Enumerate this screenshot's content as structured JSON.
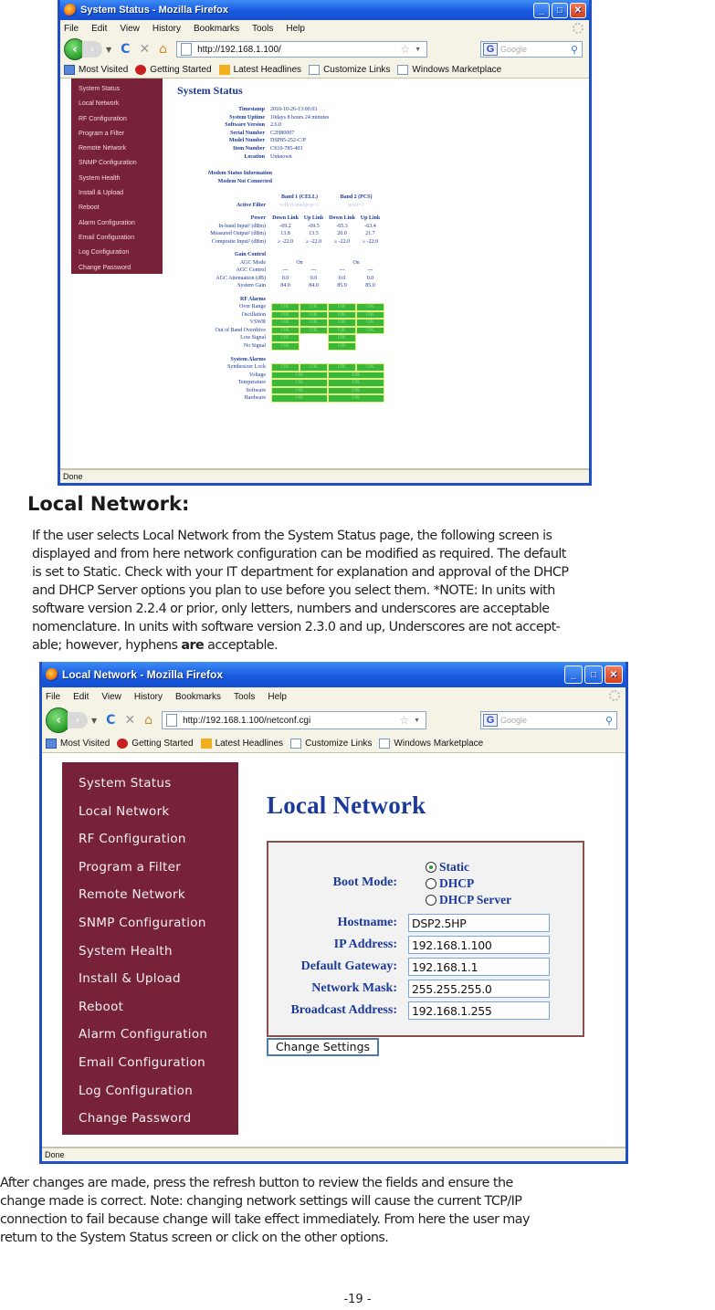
{
  "window1": {
    "title": "System Status - Mozilla Firefox",
    "menu": [
      "File",
      "Edit",
      "View",
      "History",
      "Bookmarks",
      "Tools",
      "Help"
    ],
    "url": "http://192.168.1.100/",
    "search_placeholder": "Google",
    "bookmarks": [
      "Most Visited",
      "Getting Started",
      "Latest Headlines",
      "Customize Links",
      "Windows Marketplace"
    ],
    "status": "Done",
    "sidebar": [
      "System Status",
      "Local Network",
      "RF Configuration",
      "Program a Filter",
      "Remote Network",
      "SNMP Configuration",
      "System Health",
      "Install & Upload",
      "Reboot",
      "Alarm Configuration",
      "Email Configuration",
      "Log Configuration",
      "Change Password"
    ],
    "page_title": "System Status",
    "info": [
      {
        "k": "Timestamp",
        "v": "2010-10-26-13:00:03"
      },
      {
        "k": "System Uptime",
        "v": "10days 8 hours 24 minutes"
      },
      {
        "k": "Software Version",
        "v": "2.6.0"
      },
      {
        "k": "Serial Number",
        "v": "C2H80007"
      },
      {
        "k": "Model Number",
        "v": "DSP85-252-C/P"
      },
      {
        "k": "Item Number",
        "v": "CS10-785-403"
      },
      {
        "k": "Location",
        "v": "Unknown"
      }
    ],
    "modem_heading": "Modem Status Information",
    "modem_status": "Modem Not Connected",
    "band1": "Band 1 (CELL)",
    "band2": "Band 2 (PCS)",
    "active_filter_label": "Active Filter",
    "active_filter_band1": "cellcrtomsbpcp=1",
    "active_filter_band2": "pcs0=1",
    "power_label": "Power",
    "link_headers": [
      "Down Link",
      "Up Link",
      "Down Link",
      "Up Link"
    ],
    "power_rows": [
      {
        "label": "In-band Input² (dBm)",
        "values": [
          "-69.2",
          "-69.5",
          "-65.3",
          "-63.4"
        ]
      },
      {
        "label": "Measured Output² (dBm)",
        "values": [
          "13.8",
          "13.5",
          "20.0",
          "21.7"
        ]
      },
      {
        "label": "Composite Input² (dBm)",
        "values": [
          "≥ -22.0",
          "≥ -22.0",
          "≥ -22.0",
          "≥ -22.0"
        ]
      }
    ],
    "gain_heading": "Gain Control",
    "agc_mode_label": "AGC Mode",
    "agc_mode_band1": "On",
    "agc_mode_band2": "On",
    "gain_rows": [
      {
        "label": "AGC Control",
        "values": [
          "---",
          "---",
          "---",
          "---"
        ]
      },
      {
        "label": "AGC Attenuation (dB)",
        "values": [
          "0.0",
          "0.0",
          "0.0",
          "0.0"
        ]
      },
      {
        "label": "System Gain",
        "values": [
          "84.0",
          "84.0",
          "85.0",
          "85.0"
        ]
      }
    ],
    "rf_alarms_heading": "RF Alarms",
    "rf_alarms": [
      {
        "label": "Over Range",
        "values": [
          "OK",
          "OK",
          "OK",
          "OK"
        ]
      },
      {
        "label": "Oscillation",
        "values": [
          "OK",
          "OK",
          "OK",
          "OK"
        ]
      },
      {
        "label": "VSWR",
        "values": [
          "OK",
          "OK",
          "OK",
          "OK"
        ]
      },
      {
        "label": "Out of Band Overdrive",
        "values": [
          "OK",
          "OK",
          "OK",
          "OK"
        ]
      },
      {
        "label": "Low Signal",
        "values": [
          "OK",
          "",
          "OK",
          ""
        ]
      },
      {
        "label": "No Signal",
        "values": [
          "OK",
          "",
          "OK",
          ""
        ]
      }
    ],
    "system_alarms_heading": "System Alarms",
    "synth_lock": {
      "label": "Synthesizer Lock",
      "values": [
        "OK",
        "OK",
        "OK",
        "OK"
      ]
    },
    "system_alarms": [
      {
        "label": "Voltage",
        "values": [
          "OK",
          "OK"
        ]
      },
      {
        "label": "Temperature",
        "values": [
          "OK",
          "OK"
        ]
      },
      {
        "label": "Software",
        "values": [
          "OK",
          "OK"
        ]
      },
      {
        "label": "Hardware",
        "values": [
          "OK",
          "OK"
        ]
      }
    ]
  },
  "doc": {
    "heading": "Local Network:",
    "para1": "If the user selects Local Network from the System Status page, the following screen is\ndisplayed and from here network configuration can be modified as required. The default\nis set to Static. Check with your IT department for explanation and approval of the DHCP\nand DHCP Server options you plan to use before you select them. *NOTE:  In units with\nsoftware version 2.2.4 or prior, only letters, numbers and underscores are acceptable\nnomenclature.  In units with software version 2.3.0 and up, Underscores are not accept-\nable; however, hyphens ",
    "para1_bold": "are",
    "para1_end": " acceptable.",
    "para2": "After changes are made, press the refresh button to review the fields and ensure the\nchange made is correct. Note: changing network settings will cause the current TCP/IP\nconnection to fail because change will  take effect immediately. From here the user may\nreturn to the System Status screen or click on the other options.",
    "page_number": "-19 -"
  },
  "window2": {
    "title": "Local Network - Mozilla Firefox",
    "menu": [
      "File",
      "Edit",
      "View",
      "History",
      "Bookmarks",
      "Tools",
      "Help"
    ],
    "url": "http://192.168.1.100/netconf.cgi",
    "search_placeholder": "Google",
    "bookmarks": [
      "Most Visited",
      "Getting Started",
      "Latest Headlines",
      "Customize Links",
      "Windows Marketplace"
    ],
    "status": "Done",
    "sidebar": [
      "System Status",
      "Local Network",
      "RF Configuration",
      "Program a Filter",
      "Remote Network",
      "SNMP Configuration",
      "System Health",
      "Install & Upload",
      "Reboot",
      "Alarm Configuration",
      "Email Configuration",
      "Log Configuration",
      "Change Password"
    ],
    "page_title": "Local Network",
    "boot_mode_label": "Boot Mode:",
    "boot_options": [
      {
        "label": "Static",
        "selected": true
      },
      {
        "label": "DHCP",
        "selected": false
      },
      {
        "label": "DHCP Server",
        "selected": false
      }
    ],
    "fields": [
      {
        "label": "Hostname:",
        "value": "DSP2.5HP"
      },
      {
        "label": "IP Address:",
        "value": "192.168.1.100"
      },
      {
        "label": "Default Gateway:",
        "value": "192.168.1.1"
      },
      {
        "label": "Network Mask:",
        "value": "255.255.255.0"
      },
      {
        "label": "Broadcast Address:",
        "value": "192.168.1.255"
      }
    ],
    "submit_label": "Change Settings"
  }
}
